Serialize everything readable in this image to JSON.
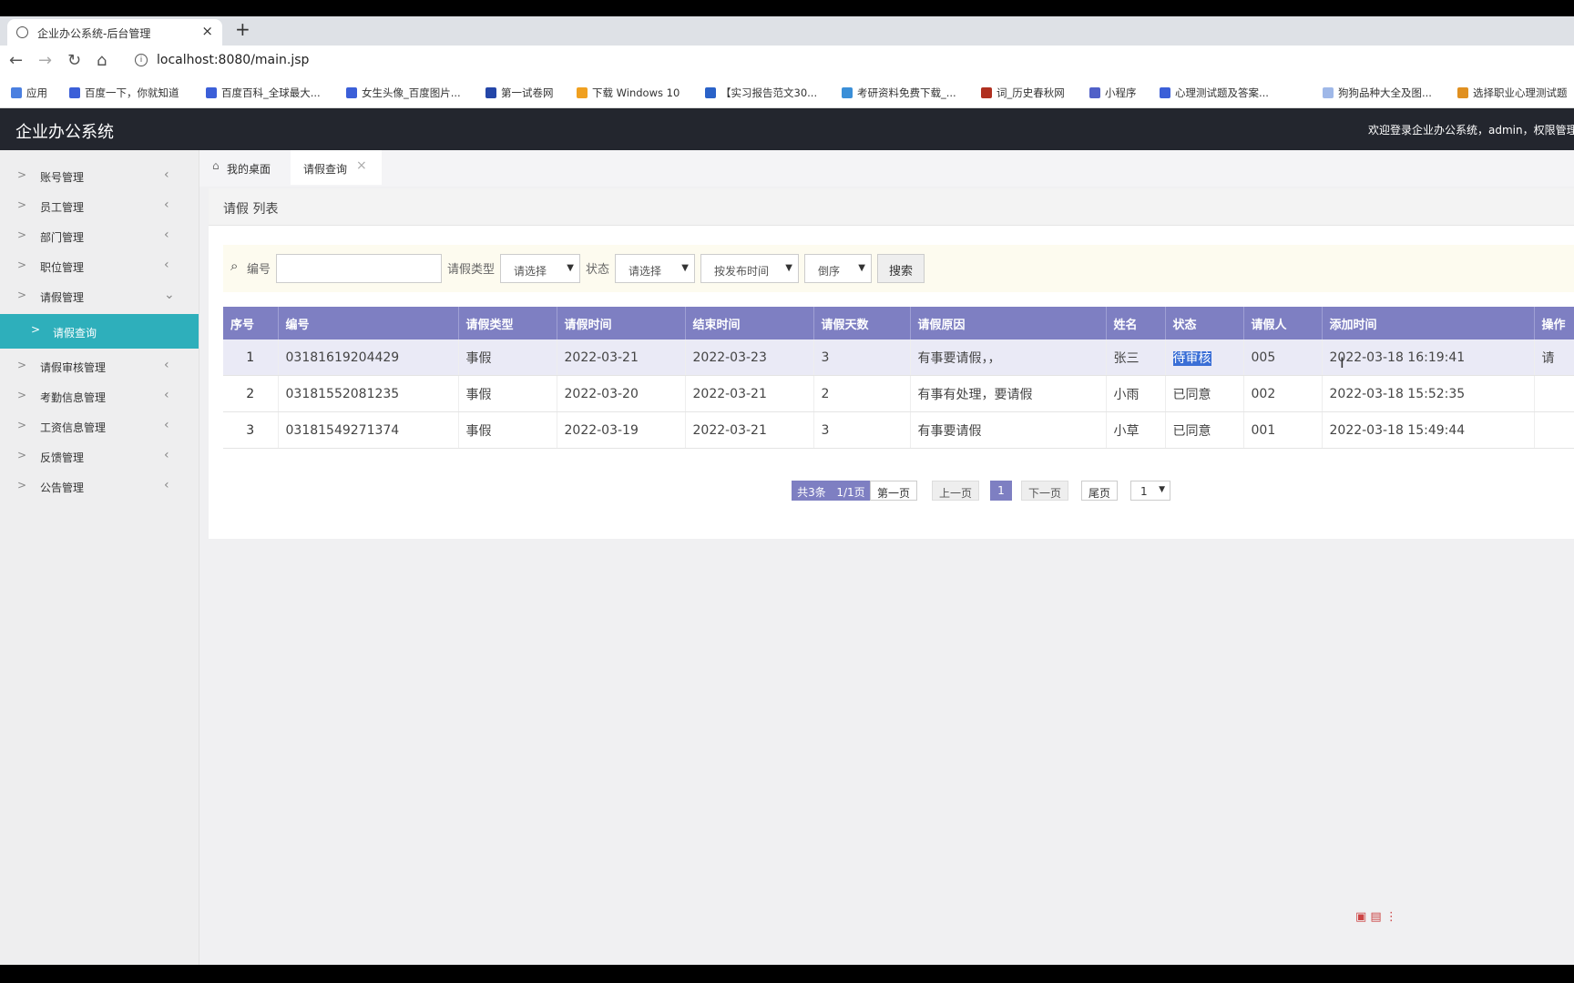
{
  "browser": {
    "tab_title": "企业办公系统-后台管理",
    "tab_close": "×",
    "new_tab": "+",
    "url": "localhost:8080/main.jsp",
    "bookmarks": [
      "应用",
      "百度一下，你就知道",
      "百度百科_全球最大...",
      "女生头像_百度图片...",
      "第一试卷网",
      "下载 Windows 10",
      "【实习报告范文30...",
      "考研资料免费下载_...",
      "词_历史春秋网",
      "小程序",
      "心理测试题及答案...",
      "狗狗品种大全及图...",
      "选择职业心理测试题"
    ]
  },
  "header": {
    "brand": "企业办公系统",
    "welcome": "欢迎登录企业办公系统，admin，权限管理"
  },
  "sidebar": {
    "items": [
      {
        "label": "账号管理"
      },
      {
        "label": "员工管理"
      },
      {
        "label": "部门管理"
      },
      {
        "label": "职位管理"
      },
      {
        "label": "请假管理"
      },
      {
        "label": "请假查询"
      },
      {
        "label": "请假审核管理"
      },
      {
        "label": "考勤信息管理"
      },
      {
        "label": "工资信息管理"
      },
      {
        "label": "反馈管理"
      },
      {
        "label": "公告管理"
      }
    ]
  },
  "content_tabs": {
    "home": "我的桌面",
    "current": "请假查询",
    "close": "×"
  },
  "panel": {
    "title": "请假 列表"
  },
  "search": {
    "id_label": "编号",
    "id_value": "",
    "type_label": "请假类型",
    "type_value": "请选择",
    "status_label": "状态",
    "status_value": "请选择",
    "sort_field": "按发布时间",
    "sort_order": "倒序",
    "button": "搜索"
  },
  "table": {
    "columns": [
      "序号",
      "编号",
      "请假类型",
      "请假时间",
      "结束时间",
      "请假天数",
      "请假原因",
      "姓名",
      "状态",
      "请假人",
      "添加时间",
      "操作"
    ],
    "rows": [
      {
        "seq": "1",
        "id": "03181619204429",
        "type": "事假",
        "start": "2022-03-21",
        "end": "2022-03-23",
        "days": "3",
        "reason": "有事要请假，，",
        "name": "张三",
        "status": "待审核",
        "applicant": "005",
        "added": "2022-03-18 16:19:41",
        "op": "请"
      },
      {
        "seq": "2",
        "id": "03181552081235",
        "type": "事假",
        "start": "2022-03-20",
        "end": "2022-03-21",
        "days": "2",
        "reason": "有事有处理，要请假",
        "name": "小雨",
        "status": "已同意",
        "applicant": "002",
        "added": "2022-03-18 15:52:35",
        "op": ""
      },
      {
        "seq": "3",
        "id": "03181549271374",
        "type": "事假",
        "start": "2022-03-19",
        "end": "2022-03-21",
        "days": "3",
        "reason": "有事要请假",
        "name": "小草",
        "status": "已同意",
        "applicant": "001",
        "added": "2022-03-18 15:49:44",
        "op": ""
      }
    ]
  },
  "pager": {
    "total": "共3条",
    "page_info": "1/1页",
    "first": "第一页",
    "prev": "上一页",
    "current": "1",
    "next": "下一页",
    "last": "尾页",
    "jump": "1"
  },
  "colors": {
    "header_bg": "#23262e",
    "table_header": "#7e7fc2",
    "active_menu": "#2eafbb"
  }
}
